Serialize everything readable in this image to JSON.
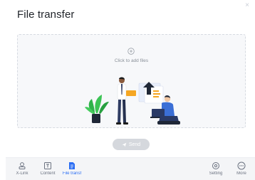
{
  "window": {
    "title": "File transfer",
    "close_glyph": "×"
  },
  "dropzone": {
    "add_icon": "plus-circle-icon",
    "hint": "Click to add files"
  },
  "send": {
    "label": "Send",
    "icon": "send-icon"
  },
  "toolbar": {
    "items": [
      {
        "label": "X-Link",
        "icon": "link-icon"
      },
      {
        "label": "Content",
        "icon": "content-icon"
      },
      {
        "label": "File transf",
        "icon": "file-transfer-icon"
      },
      {
        "label": "Setting",
        "icon": "gear-icon"
      },
      {
        "label": "More",
        "icon": "more-icon"
      }
    ],
    "active": "File transf"
  },
  "colors": {
    "accent": "#2b6ef3",
    "send_disabled": "#d5d8dd",
    "toolbar_bg": "#f4f5f7"
  }
}
